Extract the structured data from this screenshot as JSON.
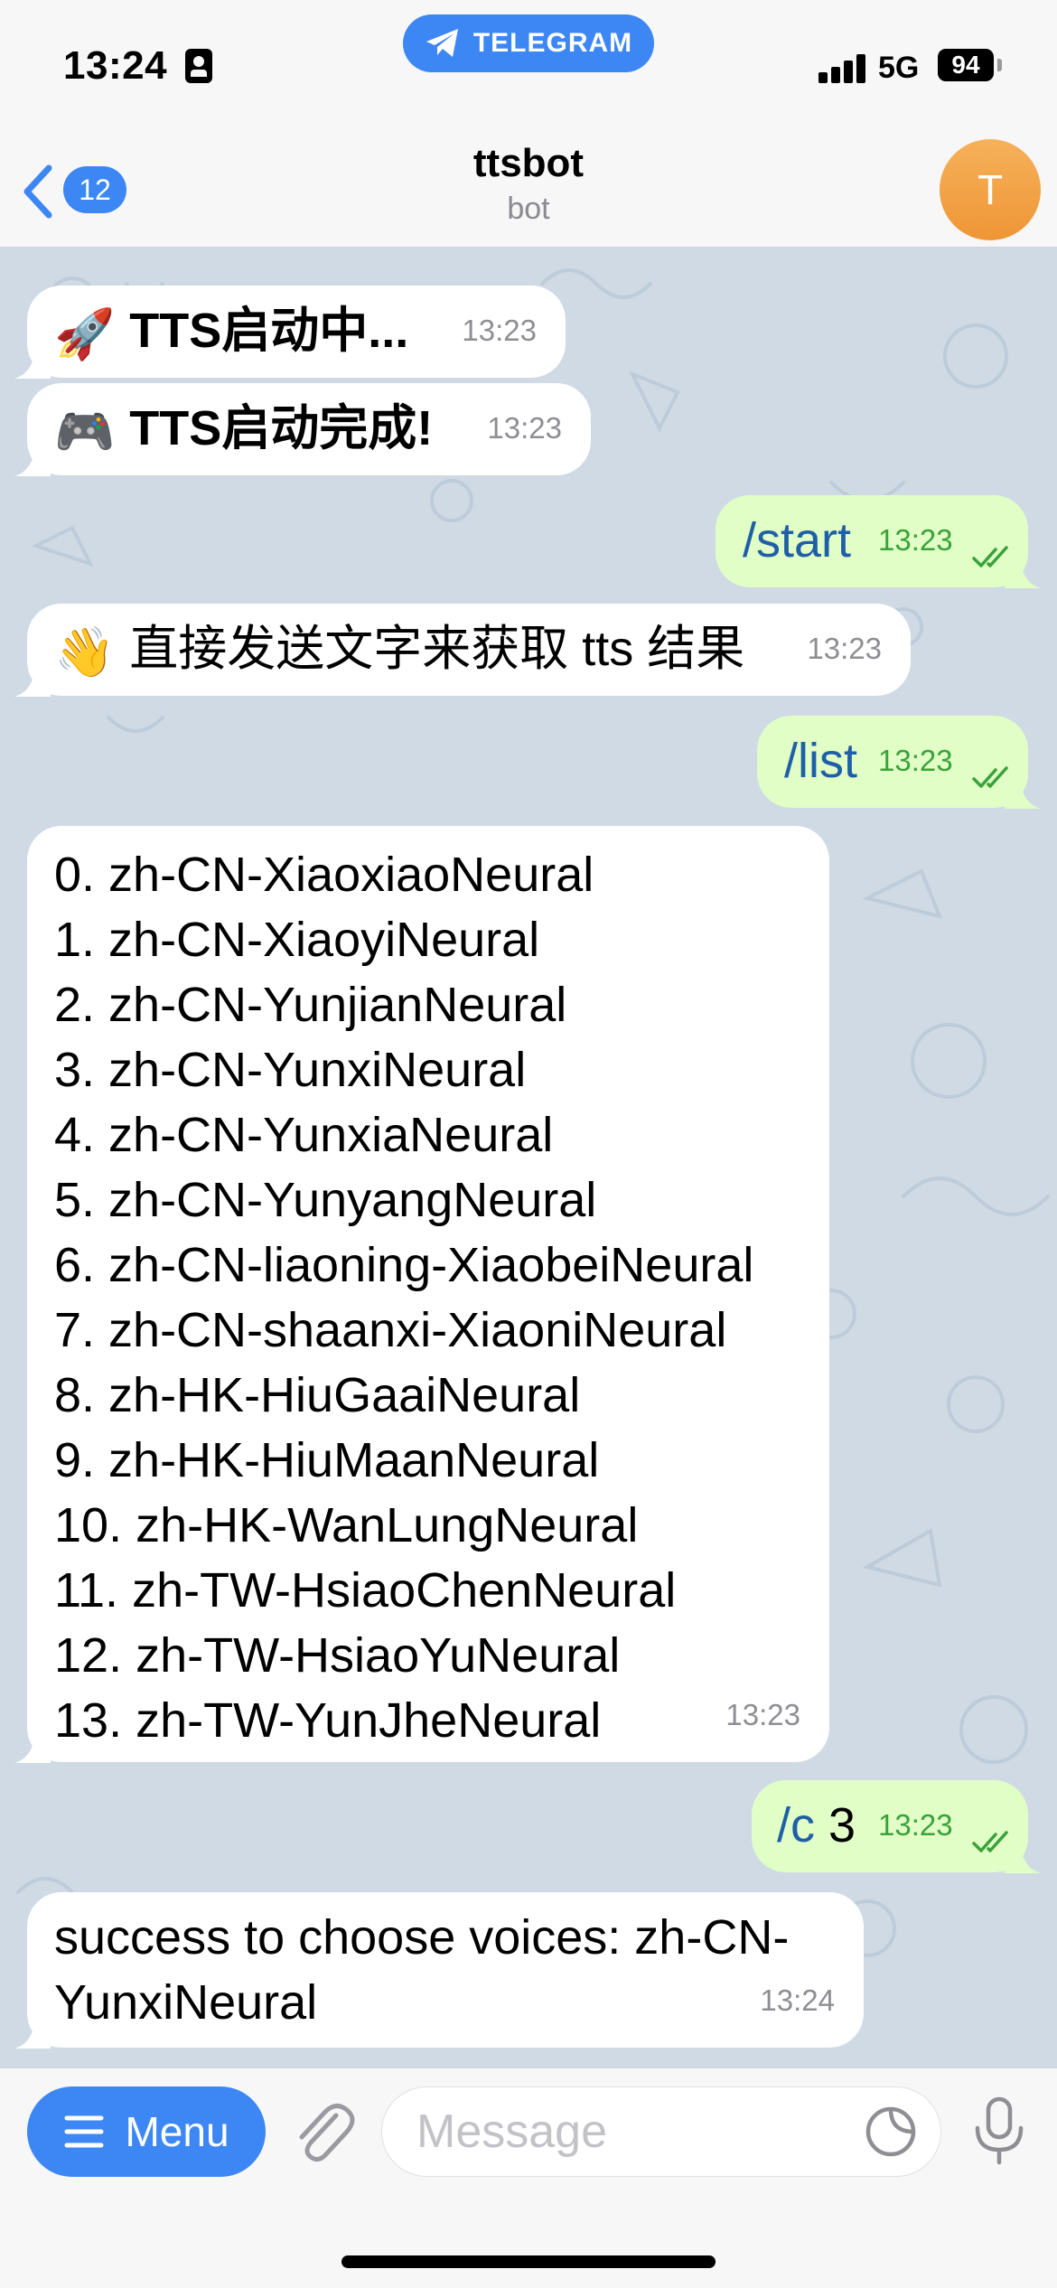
{
  "status_bar": {
    "time": "13:24",
    "pill_label": "TELEGRAM",
    "network": "5G",
    "battery": "94"
  },
  "header": {
    "back_badge": "12",
    "title": "ttsbot",
    "subtitle": "bot",
    "avatar_letter": "T"
  },
  "messages": [
    {
      "dir": "in",
      "emoji": "🚀",
      "text": "TTS启动中...",
      "time": "13:23"
    },
    {
      "dir": "in",
      "emoji": "🎮",
      "text": "TTS启动完成!",
      "time": "13:23"
    },
    {
      "dir": "out",
      "text": "/start",
      "time": "13:23"
    },
    {
      "dir": "in",
      "emoji": "👋",
      "text": "直接发送文字来获取 tts 结果",
      "time": "13:23"
    },
    {
      "dir": "out",
      "text": "/list",
      "time": "13:23"
    },
    {
      "dir": "in",
      "text": "0. zh-CN-XiaoxiaoNeural\n1. zh-CN-XiaoyiNeural\n2. zh-CN-YunjianNeural\n3. zh-CN-YunxiNeural\n4. zh-CN-YunxiaNeural\n5. zh-CN-YunyangNeural\n6. zh-CN-liaoning-XiaobeiNeural\n7. zh-CN-shaanxi-XiaoniNeural\n8. zh-HK-HiuGaaiNeural\n9. zh-HK-HiuMaanNeural\n10. zh-HK-WanLungNeural\n11. zh-TW-HsiaoChenNeural\n12. zh-TW-HsiaoYuNeural\n13. zh-TW-YunJheNeural",
      "time": "13:23"
    },
    {
      "dir": "out",
      "command": "/c",
      "arg": " 3",
      "time": "13:23"
    },
    {
      "dir": "in",
      "text": "success to choose voices: zh-CN-\nYunxiNeural",
      "time": "13:24"
    }
  ],
  "input_bar": {
    "menu_label": "Menu",
    "placeholder": "Message"
  },
  "colors": {
    "accent": "#3d87f5",
    "outgoing_bubble": "#e1fec6",
    "incoming_bubble": "#ffffff",
    "chat_background": "#cfdae5",
    "read_ticks": "#39a23a",
    "avatar": "#f2a046"
  },
  "icons": [
    "focus-icon",
    "telegram-plane-icon",
    "signal-icon",
    "battery-icon",
    "back-chevron-icon",
    "rocket-emoji",
    "gamepad-emoji",
    "waving-hand-emoji",
    "read-ticks-icon",
    "menu-lines-icon",
    "paperclip-icon",
    "sticker-icon",
    "microphone-icon"
  ]
}
